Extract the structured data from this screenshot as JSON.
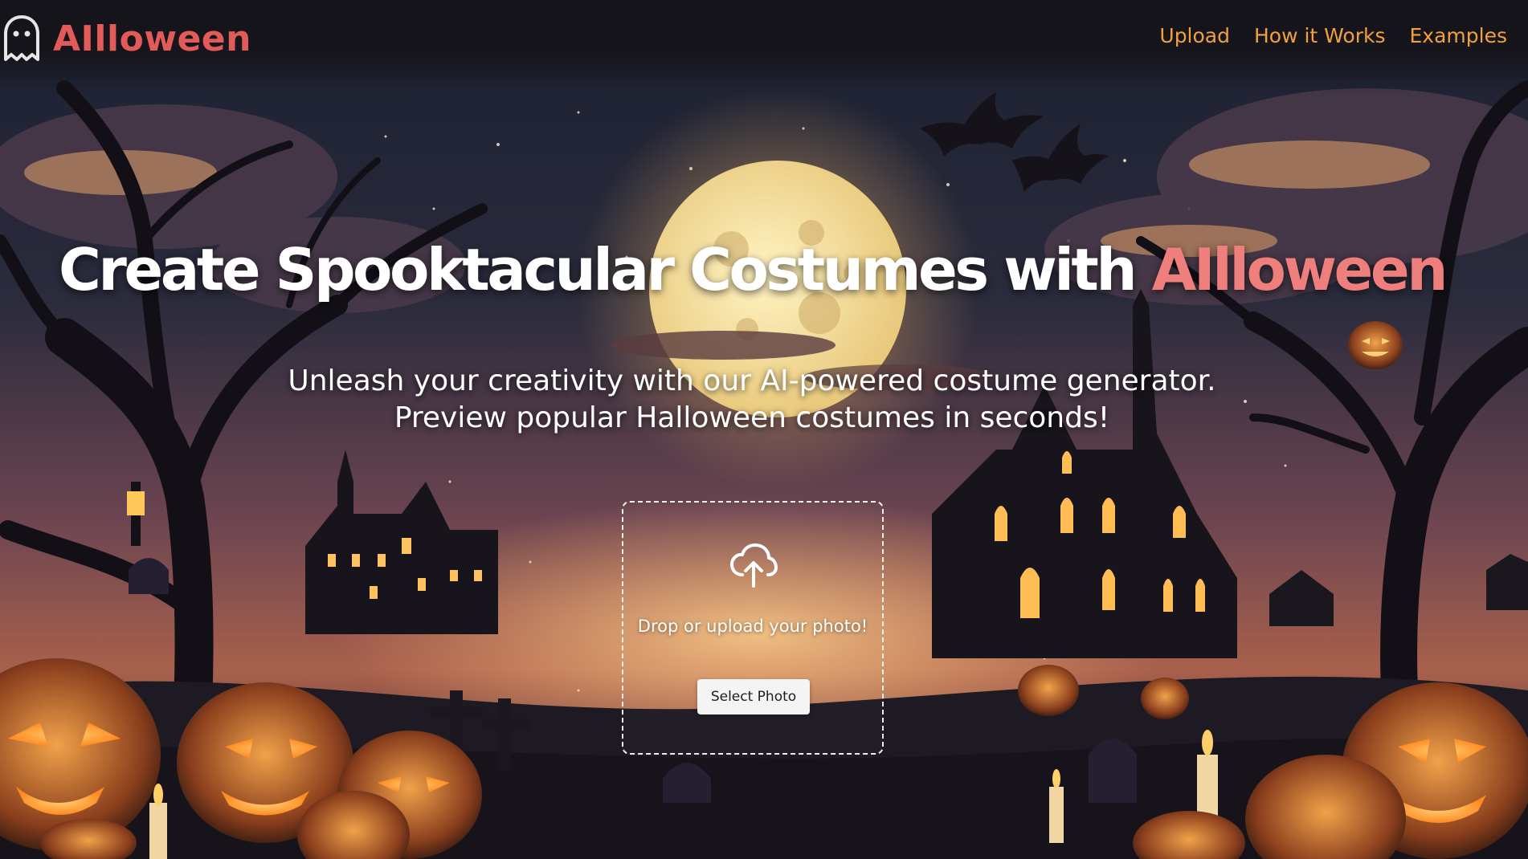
{
  "header": {
    "logo_text": "AIlloween",
    "logo_icon": "ghost-icon"
  },
  "nav": {
    "items": [
      {
        "label": "Upload"
      },
      {
        "label": "How it Works"
      },
      {
        "label": "Examples"
      }
    ]
  },
  "hero": {
    "title_prefix": "Create Spooktacular Costumes with ",
    "title_brand": "AIlloween",
    "subtitle_line1": "Unleash your creativity with our AI-powered costume generator.",
    "subtitle_line2": "Preview popular Halloween costumes in seconds!"
  },
  "upload": {
    "icon": "cloud-upload-icon",
    "prompt": "Drop or upload your photo!",
    "button_label": "Select Photo"
  },
  "colors": {
    "brand": "#e35b59",
    "nav_link": "#f1a03e",
    "title_brand": "#ef7f7d"
  }
}
